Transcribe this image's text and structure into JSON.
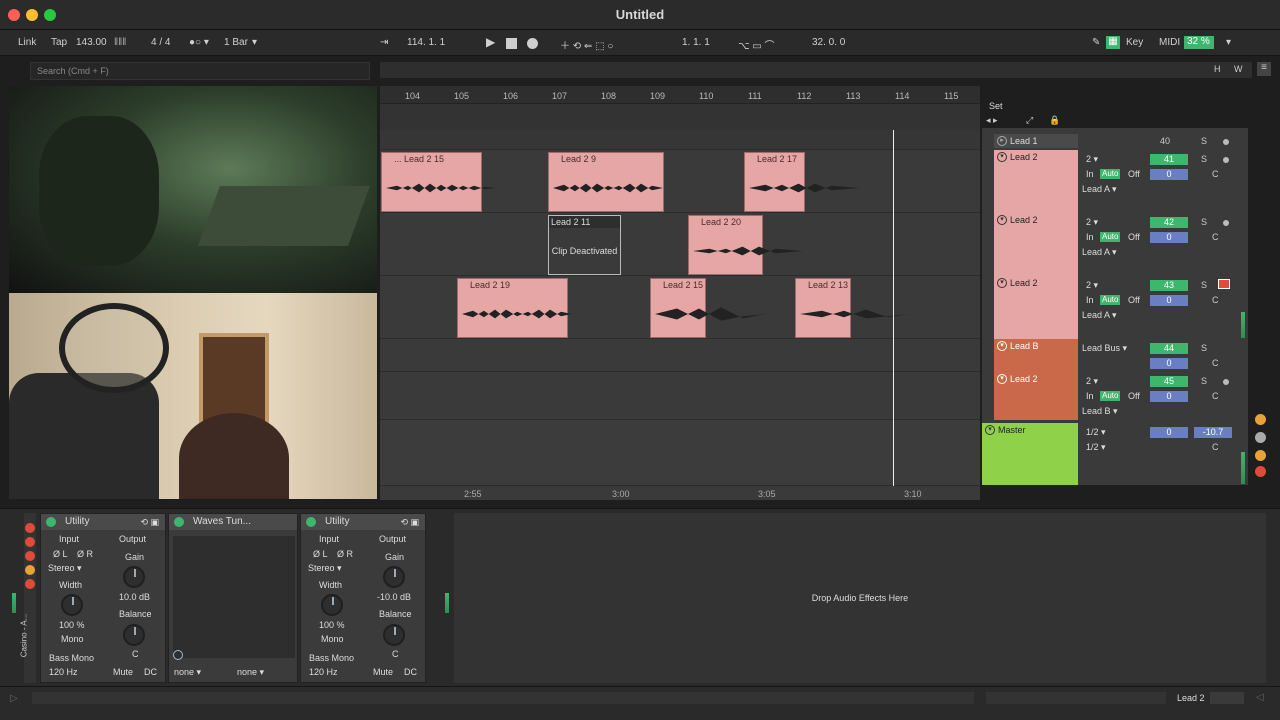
{
  "window": {
    "title": "Untitled"
  },
  "control_bar": {
    "link": "Link",
    "tap": "Tap",
    "tempo": "143.00",
    "time_sig": "4 / 4",
    "quantize": "1 Bar",
    "position": "114.  1.  1",
    "loop_start": "1.  1.  1",
    "loop_length": "32.  0.  0",
    "key": "Key",
    "midi": "MIDI",
    "cpu": "32 %"
  },
  "browser": {
    "search_placeholder": "Search (Cmd + F)"
  },
  "arrangement": {
    "bars": [
      "104",
      "105",
      "106",
      "107",
      "108",
      "109",
      "110",
      "111",
      "112",
      "113",
      "114",
      "115"
    ],
    "times": [
      "2:55",
      "3:00",
      "3:05",
      "3:10"
    ],
    "set_label": "Set",
    "clips": [
      {
        "name": "... Lead 2 15"
      },
      {
        "name": "Lead 2 9"
      },
      {
        "name": "Lead 2 17"
      },
      {
        "name": "Lead 2 11",
        "note": "Clip Deactivated"
      },
      {
        "name": "Lead 2 20"
      },
      {
        "name": "Lead 2 19"
      },
      {
        "name": "Lead 2 15"
      },
      {
        "name": "Lead 2 13"
      }
    ]
  },
  "mixer": {
    "tracks": [
      {
        "name": "Lead 1",
        "num": "40"
      },
      {
        "name": "Lead 2",
        "num": "41",
        "input": "2",
        "output": "Lead A",
        "vol": "0"
      },
      {
        "name": "Lead 2",
        "num": "42",
        "input": "2",
        "output": "Lead A",
        "vol": "0"
      },
      {
        "name": "Lead 2",
        "num": "43",
        "input": "2",
        "output": "Lead A",
        "vol": "0"
      },
      {
        "name": "Lead B",
        "num": "44",
        "input": "Lead Bus",
        "vol": "0"
      },
      {
        "name": "Lead 2",
        "num": "45",
        "input": "2",
        "output": "Lead B",
        "vol": "0"
      },
      {
        "name": "Master",
        "input": "1/2",
        "output": "1/2",
        "vol": "0",
        "peak": "-10.7"
      }
    ],
    "in": "In",
    "auto": "Auto",
    "off": "Off",
    "solo": "S",
    "center": "C"
  },
  "devices": {
    "utility1": {
      "title": "Utility",
      "input": "Input",
      "output": "Output",
      "phase_l": "Ø L",
      "phase_r": "Ø R",
      "stereo": "Stereo",
      "width": "Width",
      "width_val": "100 %",
      "mono": "Mono",
      "bass_mono": "Bass Mono",
      "bass_freq": "120 Hz",
      "gain": "Gain",
      "gain_val": "10.0 dB",
      "balance": "Balance",
      "balance_val": "C",
      "mute": "Mute",
      "dc": "DC"
    },
    "waves": {
      "title": "Waves Tun...",
      "sel1": "none",
      "sel2": "none"
    },
    "utility2": {
      "title": "Utility",
      "input": "Input",
      "output": "Output",
      "phase_l": "Ø L",
      "phase_r": "Ø R",
      "stereo": "Stereo",
      "width": "Width",
      "width_val": "100 %",
      "mono": "Mono",
      "bass_mono": "Bass Mono",
      "bass_freq": "120 Hz",
      "gain": "Gain",
      "gain_val": "-10.0 dB",
      "balance": "Balance",
      "balance_val": "C",
      "mute": "Mute",
      "dc": "DC"
    },
    "drop_hint": "Drop Audio Effects Here",
    "rack_name": "Casino - A..."
  },
  "status": {
    "selected_track": "Lead 2"
  },
  "colors": {
    "clip": "#e7a6a6",
    "green": "#3fb66d",
    "blue": "#6a7ec4",
    "master": "#8fd24a",
    "lead_b": "#c9694a"
  }
}
